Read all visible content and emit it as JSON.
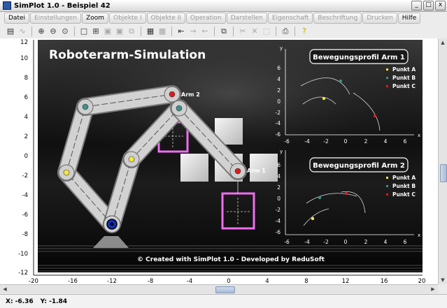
{
  "window": {
    "title": "SimPlot 1.0 - Beispiel 42",
    "minimize": "_",
    "maximize": "□",
    "close": "x"
  },
  "menu": [
    {
      "label": "Datei",
      "enabled": true
    },
    {
      "label": "Einstellungen",
      "enabled": false
    },
    {
      "label": "Zoom",
      "enabled": true
    },
    {
      "label": "Objekte I",
      "enabled": false
    },
    {
      "label": "Objekte II",
      "enabled": false
    },
    {
      "label": "Operation",
      "enabled": false
    },
    {
      "label": "Darstellen",
      "enabled": false
    },
    {
      "label": "Eigenschaft",
      "enabled": false
    },
    {
      "label": "Beschriftung",
      "enabled": false
    },
    {
      "label": "Drucken",
      "enabled": false
    },
    {
      "label": "Hilfe",
      "enabled": true
    }
  ],
  "axes": {
    "x_ticks": [
      "-20",
      "-16",
      "-12",
      "-8",
      "-4",
      "0",
      "4",
      "8",
      "12",
      "16",
      "20"
    ],
    "y_ticks": [
      "12",
      "10",
      "8",
      "6",
      "4",
      "2",
      "0",
      "-2",
      "-4",
      "-6",
      "-8",
      "-10",
      "-12"
    ]
  },
  "scene": {
    "title": "Roboterarm-Simulation",
    "footer": "© Created with SimPlot 1.0 - Developed by ReduSoft",
    "arm1_label": "Arm 1",
    "arm2_label": "Arm 2"
  },
  "panel1": {
    "title": "Bewegungsprofil Arm 1",
    "x_ticks": [
      "-6",
      "-4",
      "-2",
      "0",
      "2",
      "4",
      "6"
    ],
    "y_ticks": [
      "6",
      "4",
      "2",
      "0",
      "-2",
      "-4",
      "-6"
    ],
    "x_label": "x",
    "y_label": "y"
  },
  "panel2": {
    "title": "Bewegungsprofil Arm 2",
    "x_ticks": [
      "-6",
      "-4",
      "-2",
      "0",
      "2",
      "4",
      "6"
    ],
    "y_ticks": [
      "6",
      "4",
      "2",
      "0",
      "-2",
      "-4",
      "-6"
    ],
    "x_label": "x",
    "y_label": "y"
  },
  "legend": [
    {
      "label": "Punkt A",
      "color": "#f5e642"
    },
    {
      "label": "Punkt B",
      "color": "#3f8f8a"
    },
    {
      "label": "Punkt C",
      "color": "#d81e1e"
    }
  ],
  "status": {
    "x": "X: -6.36",
    "y": "Y: -1.84"
  }
}
